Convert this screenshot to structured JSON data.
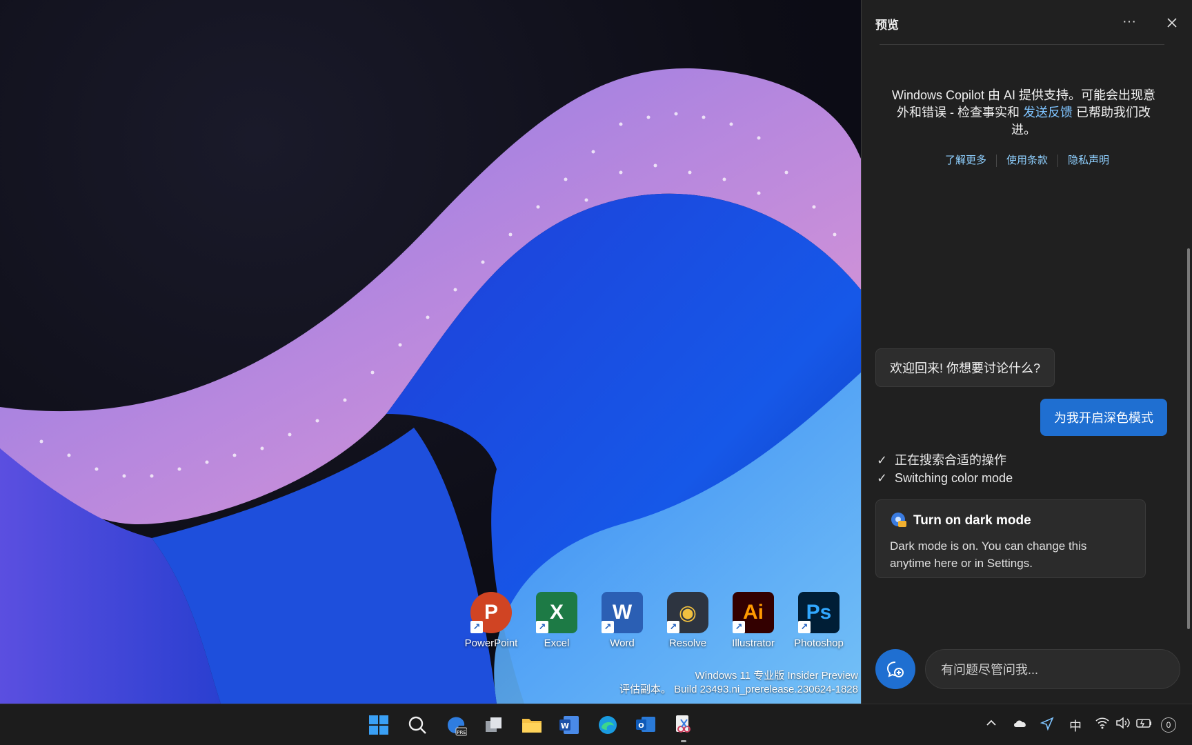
{
  "desktop": {
    "icons": [
      {
        "label": "PowerPoint",
        "glyph": "P",
        "color": "#d04423",
        "icon": "powerpoint-icon"
      },
      {
        "label": "Excel",
        "glyph": "X",
        "color": "#1d7a45",
        "icon": "excel-icon"
      },
      {
        "label": "Word",
        "glyph": "W",
        "color": "#2b5fb4",
        "icon": "word-icon"
      },
      {
        "label": "Resolve",
        "glyph": "◉",
        "color": "#2d3440",
        "icon": "resolve-icon"
      },
      {
        "label": "Illustrator",
        "glyph": "Ai",
        "color": "#330000",
        "icon": "illustrator-icon"
      },
      {
        "label": "Photoshop",
        "glyph": "Ps",
        "color": "#001e36",
        "icon": "photoshop-icon"
      }
    ],
    "watermark": {
      "line1": "Windows 11 专业版 Insider Preview",
      "line2": "评估副本。 Build 23493.ni_prerelease.230624-1828"
    }
  },
  "copilot": {
    "title": "预览",
    "more": "···",
    "disclaimer": {
      "before": "Windows Copilot 由 AI 提供支持。可能会出现意外和错误 - 检查事实和 ",
      "link": "发送反馈",
      "after": " 已帮助我们改进。"
    },
    "links": [
      "了解更多",
      "使用条款",
      "隐私声明"
    ],
    "welcome": "欢迎回来! 你想要讨论什么?",
    "user_message": "为我开启深色模式",
    "steps": [
      "正在搜索合适的操作",
      "Switching color mode"
    ],
    "card": {
      "title": "Turn on dark mode",
      "body": "Dark mode is on. You can change this anytime here or in Settings."
    },
    "input_placeholder": "有问题尽管问我..."
  },
  "taskbar": {
    "apps": [
      "start-icon",
      "search-icon",
      "copilot-icon",
      "task-view-icon",
      "file-explorer-icon",
      "word-icon",
      "edge-icon",
      "outlook-icon",
      "snipping-tool-icon"
    ],
    "tray": {
      "ime": "中",
      "notifications": "0"
    }
  },
  "colors": {
    "accent": "#1f6fd1",
    "panel_bg": "#202020",
    "link": "#8fd0ff"
  }
}
